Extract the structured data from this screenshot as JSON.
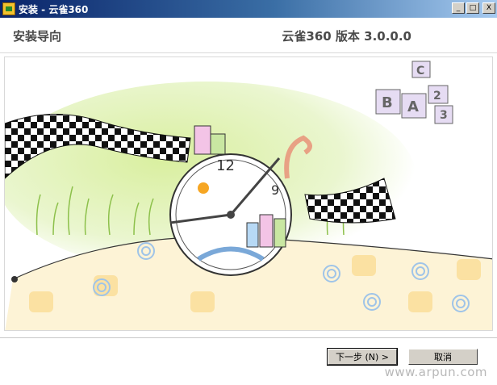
{
  "window": {
    "title": "安装 - 云雀360",
    "minimize_label": "_",
    "maximize_label": "□",
    "close_label": "X"
  },
  "header": {
    "title": "安装导向",
    "version": "云雀360 版本 3.0.0.0"
  },
  "banner": {
    "clock_numbers": [
      "12",
      "9"
    ],
    "blocks_letters": [
      "C",
      "B",
      "A",
      "2",
      "3"
    ]
  },
  "buttons": {
    "next": "下一步 (N) >",
    "cancel": "取消"
  },
  "watermark": "www.arpun.com",
  "colors": {
    "titlebar_start": "#0a246a",
    "titlebar_end": "#a6caf0",
    "button_face": "#d4d0c8",
    "header_text": "#4a4a4a"
  }
}
